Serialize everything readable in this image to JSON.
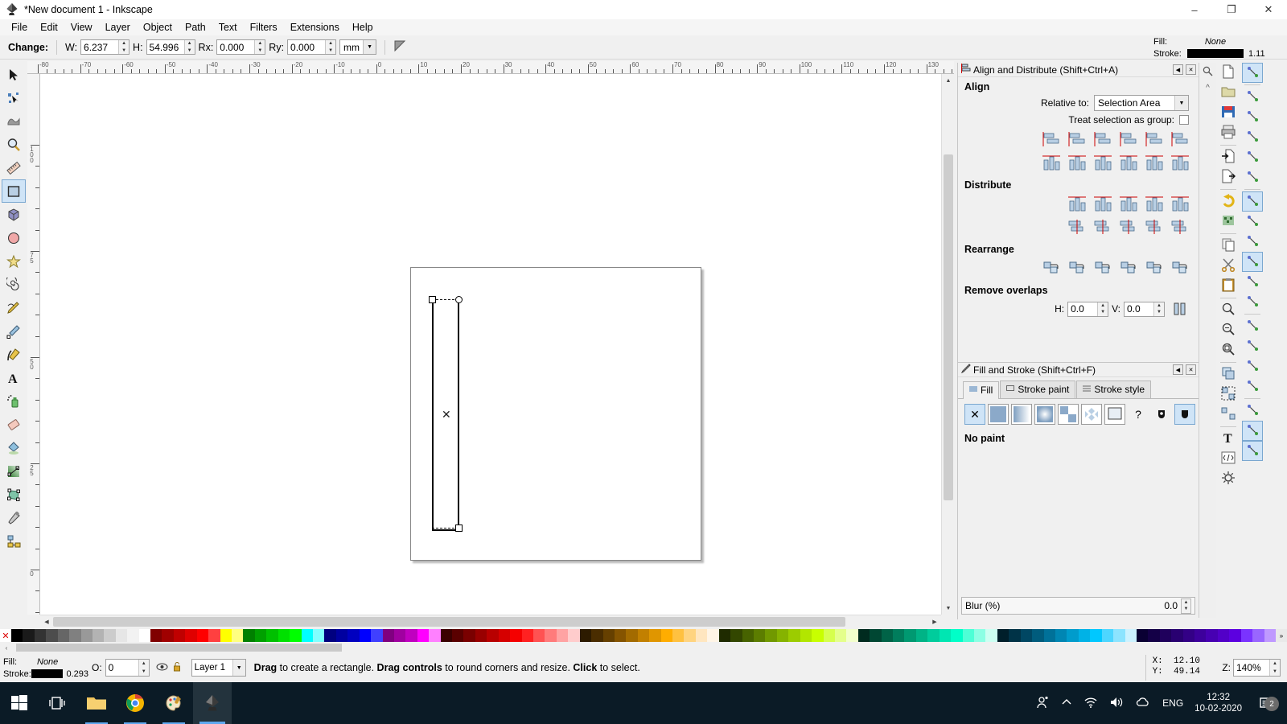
{
  "window": {
    "title": "*New document 1 - Inkscape",
    "app_icon": "inkscape-logo-icon",
    "minimize": "–",
    "maximize": "❐",
    "close": "✕"
  },
  "menu": {
    "items": [
      {
        "label": "File",
        "accel": "F"
      },
      {
        "label": "Edit",
        "accel": "E"
      },
      {
        "label": "View",
        "accel": "V"
      },
      {
        "label": "Layer",
        "accel": "L"
      },
      {
        "label": "Object",
        "accel": "O"
      },
      {
        "label": "Path",
        "accel": "P"
      },
      {
        "label": "Text",
        "accel": "T"
      },
      {
        "label": "Filters",
        "accel": "s"
      },
      {
        "label": "Extensions",
        "accel": "n"
      },
      {
        "label": "Help",
        "accel": "H"
      }
    ]
  },
  "tool_options": {
    "change_label": "Change:",
    "w_label": "W:",
    "w_value": "6.237",
    "h_label": "H:",
    "h_value": "54.996",
    "rx_label": "Rx:",
    "rx_value": "0.000",
    "ry_label": "Ry:",
    "ry_value": "0.000",
    "unit": "mm",
    "reset_icon": "make-corners-sharp-icon"
  },
  "fill_stroke_indicator": {
    "fill_label": "Fill:",
    "fill_value": "None",
    "stroke_label": "Stroke:",
    "stroke_color": "#000000",
    "stroke_width": "1.11"
  },
  "toolbox": {
    "items": [
      {
        "name": "selector-tool",
        "icon": "arrow-cursor-icon",
        "active": false
      },
      {
        "name": "node-tool",
        "icon": "node-editor-icon",
        "active": false
      },
      {
        "name": "tweak-tool",
        "icon": "tweak-icon",
        "active": false
      },
      {
        "name": "zoom-tool",
        "icon": "magnifier-icon",
        "active": false
      },
      {
        "name": "measure-tool",
        "icon": "ruler-icon",
        "active": false
      },
      {
        "name": "rectangle-tool",
        "icon": "rectangle-icon",
        "active": true
      },
      {
        "name": "box3d-tool",
        "icon": "cube-icon",
        "active": false
      },
      {
        "name": "ellipse-tool",
        "icon": "circle-icon",
        "active": false
      },
      {
        "name": "star-tool",
        "icon": "star-icon",
        "active": false
      },
      {
        "name": "spiral-tool",
        "icon": "spiral-icon",
        "active": false
      },
      {
        "name": "pencil-tool",
        "icon": "pencil-icon",
        "active": false
      },
      {
        "name": "bezier-tool",
        "icon": "pen-icon",
        "active": false
      },
      {
        "name": "calligraphy-tool",
        "icon": "calligraphy-pen-icon",
        "active": false
      },
      {
        "name": "text-tool",
        "icon": "letter-a-icon",
        "active": false
      },
      {
        "name": "spray-tool",
        "icon": "spray-can-icon",
        "active": false
      },
      {
        "name": "eraser-tool",
        "icon": "eraser-icon",
        "active": false
      },
      {
        "name": "paint-bucket-tool",
        "icon": "paint-bucket-icon",
        "active": false
      },
      {
        "name": "gradient-tool",
        "icon": "gradient-icon",
        "active": false
      },
      {
        "name": "mesh-gradient-tool",
        "icon": "mesh-gradient-icon",
        "active": false
      },
      {
        "name": "dropper-tool",
        "icon": "eyedropper-icon",
        "active": false
      },
      {
        "name": "connector-tool",
        "icon": "connector-icon",
        "active": false
      }
    ]
  },
  "rulers": {
    "horizontal_labels": [
      "-80",
      "-70",
      "-60",
      "-50",
      "-40",
      "-30",
      "-20",
      "-10",
      "0",
      "10",
      "20",
      "30",
      "40",
      "50",
      "60",
      "70",
      "80",
      "90",
      "100",
      "110",
      "120",
      "130"
    ],
    "vertical_labels": [
      "100",
      "75",
      "50",
      "25",
      "0"
    ],
    "lock_icon": "ruler-lock-icon"
  },
  "canvas": {
    "page_label": "document-page",
    "selection": {
      "shape": "rectangle",
      "handle_top_left": "resize-handle",
      "handle_top_right": "round-corner-handle",
      "handle_bottom_right": "resize-handle",
      "center_marker": "x-marker"
    }
  },
  "align_dock": {
    "title": "Align and Distribute (Shift+Ctrl+A)",
    "icon": "align-icon",
    "collapse": "◀",
    "close": "✕",
    "align_section": "Align",
    "relative_to_label": "Relative to:",
    "relative_to_value": "Selection Area",
    "treat_as_group_label": "Treat selection as group:",
    "align_row1": [
      "align-right-edge-to-left-anchor",
      "align-left-edges",
      "center-on-vertical-axis",
      "align-right-edges",
      "align-left-edge-to-right-anchor",
      "text-anchor-vertical"
    ],
    "align_row2": [
      "align-bottom-edge-to-top-anchor",
      "align-top-edges",
      "center-on-horizontal-axis",
      "align-bottom-edges",
      "align-top-edge-to-bottom-anchor",
      "text-baseline-horizontal"
    ],
    "distribute_section": "Distribute",
    "distribute_row1": [
      "distribute-left-edges-equidistant",
      "distribute-centers-horizontally",
      "distribute-right-edges-equidistant",
      "distribute-horizontal-gaps-equal",
      "distribute-text-anchors-horizontally"
    ],
    "distribute_row2": [
      "distribute-top-edges-equidistant",
      "distribute-centers-vertically",
      "distribute-bottom-edges-equidistant",
      "distribute-vertical-gaps-equal",
      "distribute-text-baselines-vertically"
    ],
    "rearrange_section": "Rearrange",
    "rearrange_row": [
      "graph-layout",
      "exchange-positions-selection-order",
      "exchange-positions-z-order",
      "exchange-positions-clockwise",
      "randomize-positions",
      "unclump-objects"
    ],
    "remove_overlaps_section": "Remove overlaps",
    "h_label": "H:",
    "h_value": "0.0",
    "v_label": "V:",
    "v_value": "0.0",
    "remove_overlaps_icon": "remove-overlaps-icon"
  },
  "fill_stroke_dock": {
    "title": "Fill and Stroke (Shift+Ctrl+F)",
    "icon": "fill-stroke-icon",
    "collapse": "◀",
    "close": "✕",
    "tabs": [
      {
        "label": "Fill",
        "icon": "fill-swatch-icon",
        "active": true
      },
      {
        "label": "Stroke paint",
        "icon": "stroke-paint-icon",
        "active": false
      },
      {
        "label": "Stroke style",
        "icon": "stroke-style-icon",
        "active": false
      }
    ],
    "paint_buttons": [
      {
        "name": "no-paint-button",
        "glyph": "✕",
        "selected": true
      },
      {
        "name": "flat-color-button",
        "glyph": "",
        "selected": false
      },
      {
        "name": "linear-gradient-button",
        "glyph": "",
        "selected": false
      },
      {
        "name": "radial-gradient-button",
        "glyph": "",
        "selected": false
      },
      {
        "name": "pattern-button",
        "glyph": "",
        "selected": false
      },
      {
        "name": "swatch-button",
        "glyph": "",
        "selected": false
      },
      {
        "name": "mesh-gradient-button",
        "glyph": "",
        "selected": false
      },
      {
        "name": "unknown-paint-button",
        "glyph": "?",
        "selected": false
      }
    ],
    "fill_rule_even_odd": "even-odd-fill-rule-icon",
    "fill_rule_nonzero": "nonzero-fill-rule-icon",
    "status_text": "No paint",
    "blur_label": "Blur (%)",
    "blur_value": "0.0"
  },
  "command_bar": {
    "items": [
      {
        "name": "new-document-button",
        "icon": "new-file-icon"
      },
      {
        "name": "open-document-button",
        "icon": "folder-open-icon"
      },
      {
        "name": "save-document-button",
        "icon": "floppy-save-icon"
      },
      {
        "name": "print-button",
        "icon": "printer-icon"
      },
      {
        "name": "import-button",
        "icon": "import-file-icon"
      },
      {
        "name": "export-button",
        "icon": "export-file-icon"
      },
      {
        "name": "undo-button",
        "icon": "undo-arrow-icon"
      },
      {
        "name": "redo-button",
        "icon": "redo-arrow-icon"
      },
      {
        "name": "copy-button",
        "icon": "copy-icon"
      },
      {
        "name": "cut-button",
        "icon": "scissors-icon"
      },
      {
        "name": "paste-button",
        "icon": "clipboard-icon"
      },
      {
        "name": "zoom-selection-button",
        "icon": "zoom-selection-icon"
      },
      {
        "name": "zoom-drawing-button",
        "icon": "zoom-drawing-icon"
      },
      {
        "name": "zoom-page-button",
        "icon": "zoom-page-icon"
      },
      {
        "name": "duplicate-button",
        "icon": "duplicate-icon"
      },
      {
        "name": "group-button",
        "icon": "group-icon"
      },
      {
        "name": "ungroup-button",
        "icon": "ungroup-icon"
      },
      {
        "name": "text-tool-button",
        "icon": "text-icon"
      },
      {
        "name": "xml-editor-button",
        "icon": "xml-editor-icon"
      },
      {
        "name": "preferences-button",
        "icon": "preferences-icon"
      }
    ]
  },
  "snap_bar": {
    "items": [
      {
        "name": "enable-snapping-toggle",
        "icon": "snap-master-icon",
        "on": true
      },
      {
        "name": "snap-bounding-box-toggle",
        "icon": "snap-bbox-icon",
        "on": false
      },
      {
        "name": "snap-bbox-edge-toggle",
        "icon": "snap-bbox-edge-icon",
        "on": false
      },
      {
        "name": "snap-bbox-corner-toggle",
        "icon": "snap-bbox-corner-icon",
        "on": false
      },
      {
        "name": "snap-bbox-edge-midpoint-toggle",
        "icon": "snap-edge-midpoint-icon",
        "on": false
      },
      {
        "name": "snap-bbox-center-toggle",
        "icon": "snap-bbox-center-icon",
        "on": false
      },
      {
        "name": "snap-nodes-toggle",
        "icon": "snap-nodes-icon",
        "on": true
      },
      {
        "name": "snap-paths-toggle",
        "icon": "snap-path-icon",
        "on": false
      },
      {
        "name": "snap-path-intersection-toggle",
        "icon": "snap-intersection-icon",
        "on": false
      },
      {
        "name": "snap-cusp-nodes-toggle",
        "icon": "snap-cusp-node-icon",
        "on": true
      },
      {
        "name": "snap-smooth-nodes-toggle",
        "icon": "snap-smooth-node-icon",
        "on": false
      },
      {
        "name": "snap-midpoints-toggle",
        "icon": "snap-midpoint-icon",
        "on": false
      },
      {
        "name": "snap-others-toggle",
        "icon": "snap-others-icon",
        "on": false
      },
      {
        "name": "snap-object-center-toggle",
        "icon": "snap-object-center-icon",
        "on": false
      },
      {
        "name": "snap-rotation-center-toggle",
        "icon": "snap-rotation-center-icon",
        "on": false
      },
      {
        "name": "snap-text-baseline-toggle",
        "icon": "snap-text-baseline-icon",
        "on": false
      },
      {
        "name": "snap-page-border-toggle",
        "icon": "snap-page-border-icon",
        "on": false
      },
      {
        "name": "snap-grid-toggle",
        "icon": "snap-grid-icon",
        "on": true
      },
      {
        "name": "snap-guide-toggle",
        "icon": "snap-guide-icon",
        "on": true
      }
    ]
  },
  "status_bar": {
    "fill_label": "Fill:",
    "fill_value": "None",
    "stroke_label": "Stroke:",
    "stroke_color": "#000000",
    "stroke_value": "0.293",
    "opacity_label": "O:",
    "opacity_value": "0",
    "eye_icon": "layer-visible-icon",
    "lock_icon": "layer-unlocked-icon",
    "layer_value": "Layer 1",
    "hint_parts": [
      {
        "text": "Drag",
        "bold": true
      },
      {
        "text": " to create a rectangle. ",
        "bold": false
      },
      {
        "text": "Drag controls",
        "bold": true
      },
      {
        "text": " to round corners and resize. ",
        "bold": false
      },
      {
        "text": "Click",
        "bold": true
      },
      {
        "text": " to select.",
        "bold": false
      }
    ],
    "x_label": "X:",
    "x_value": "12.10",
    "y_label": "Y:",
    "y_value": "49.14",
    "zoom_label": "Z:",
    "zoom_value": "140%"
  },
  "palette": {
    "no_color_glyph": "✕",
    "colors": [
      "#000000",
      "#1a1a1a",
      "#333333",
      "#4d4d4d",
      "#666666",
      "#808080",
      "#999999",
      "#b3b3b3",
      "#cccccc",
      "#e6e6e6",
      "#f2f2f2",
      "#ffffff",
      "#800000",
      "#a00000",
      "#c00000",
      "#e00000",
      "#ff0000",
      "#ff4040",
      "#ffff00",
      "#ffff80",
      "#008000",
      "#00a000",
      "#00c000",
      "#00e000",
      "#00ff00",
      "#00ffff",
      "#80ffff",
      "#000080",
      "#0000a0",
      "#0000c0",
      "#0000ff",
      "#4040ff",
      "#800080",
      "#a000a0",
      "#c000c0",
      "#ff00ff",
      "#ff80ff",
      "#3b0000",
      "#5a0000",
      "#7a0000",
      "#990000",
      "#b80000",
      "#d60000",
      "#f50000",
      "#ff2121",
      "#ff5252",
      "#ff7b7b",
      "#ffa3a3",
      "#ffcccc",
      "#2d1b00",
      "#4a2d00",
      "#664000",
      "#855400",
      "#a36b00",
      "#c28000",
      "#e09600",
      "#ffad00",
      "#ffc140",
      "#ffd480",
      "#ffe6bf",
      "#fff5e6",
      "#1f2b00",
      "#334700",
      "#476300",
      "#5c7d00",
      "#719900",
      "#86b300",
      "#9ccc00",
      "#b2e600",
      "#c8ff00",
      "#d6ff4d",
      "#e4ff8c",
      "#f2ffcc",
      "#002b1f",
      "#004733",
      "#006347",
      "#007d5c",
      "#009971",
      "#00b386",
      "#00cc9c",
      "#00e6b2",
      "#00ffc8",
      "#4dffd6",
      "#8cffe4",
      "#ccfff2",
      "#001f2b",
      "#003347",
      "#004763",
      "#005c7d",
      "#007199",
      "#0086b3",
      "#009ccc",
      "#00b2e6",
      "#00c8ff",
      "#4dd6ff",
      "#8ce4ff",
      "#ccf2ff",
      "#0a0033",
      "#140047",
      "#1f005c",
      "#290071",
      "#330086",
      "#3d009c",
      "#4700b2",
      "#5200c8",
      "#5c00e0",
      "#7a33ff",
      "#9966ff",
      "#bf99ff"
    ],
    "scroll_left_glyph": "‹",
    "more_glyph": "»"
  },
  "taskbar": {
    "items": [
      {
        "name": "start-button",
        "icon": "windows-logo-icon",
        "state": "none"
      },
      {
        "name": "task-view-button",
        "icon": "task-view-icon",
        "state": "none"
      },
      {
        "name": "file-explorer-button",
        "icon": "folder-icon",
        "state": "open"
      },
      {
        "name": "chrome-button",
        "icon": "chrome-icon",
        "state": "open"
      },
      {
        "name": "paint-button",
        "icon": "paint-palette-icon",
        "state": "open"
      },
      {
        "name": "inkscape-button",
        "icon": "inkscape-logo-icon",
        "state": "active"
      }
    ],
    "tray": {
      "people_icon": "people-icon",
      "show_hidden_icon": "chevron-up-icon",
      "network_icon": "wifi-icon",
      "volume_icon": "speaker-icon",
      "onedrive_icon": "onedrive-icon",
      "language": "ENG",
      "time": "12:32",
      "date": "10-02-2020",
      "notification_icon": "notification-icon",
      "notification_count": "2"
    }
  }
}
